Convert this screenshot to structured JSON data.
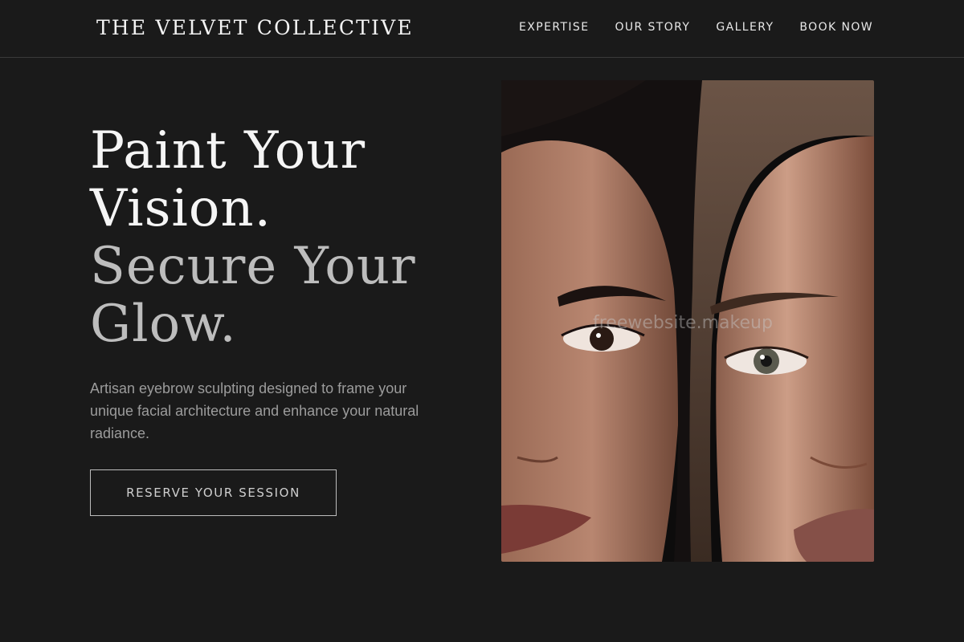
{
  "brand": {
    "name": "THE VELVET COLLECTIVE"
  },
  "nav": {
    "items": [
      {
        "label": "EXPERTISE"
      },
      {
        "label": "OUR STORY"
      },
      {
        "label": "GALLERY"
      },
      {
        "label": "BOOK NOW"
      }
    ]
  },
  "hero": {
    "headline_lines": [
      "Paint Your",
      "Vision.",
      "Secure Your",
      "Glow."
    ],
    "subtext": "Artisan eyebrow sculpting designed to frame your unique facial architecture and enhance your natural radiance.",
    "cta_label": "RESERVE YOUR SESSION",
    "image_watermark": "freewebsite.makeup"
  },
  "colors": {
    "background": "#1a1a1a",
    "headline_primary": "#f5f5f5",
    "headline_secondary": "#bdbdbd",
    "body_text": "#9c9c9c"
  }
}
